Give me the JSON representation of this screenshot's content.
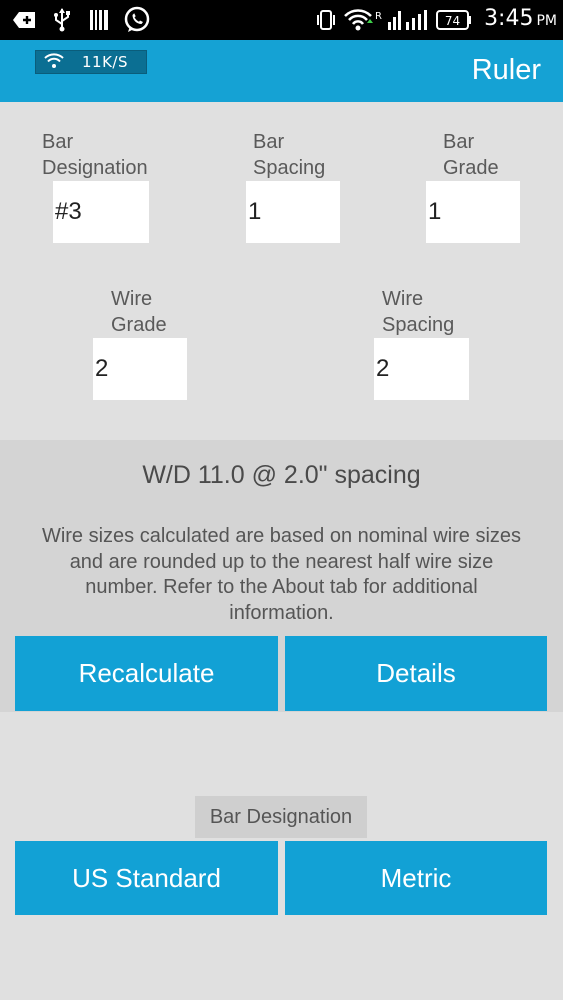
{
  "status_bar": {
    "time": "3:45",
    "ampm": "PM",
    "battery": "74",
    "net_type": "R"
  },
  "network_badge": {
    "speed": "11K/S"
  },
  "header": {
    "title": "Ruler"
  },
  "fields": {
    "bar_designation": {
      "label_line1": "Bar",
      "label_line2": "Designation",
      "value": "#3"
    },
    "bar_spacing": {
      "label_line1": "Bar",
      "label_line2": "Spacing",
      "value": "1"
    },
    "bar_grade": {
      "label_line1": "Bar",
      "label_line2": "Grade",
      "value": "1"
    },
    "wire_grade": {
      "label_line1": "Wire",
      "label_line2": "Grade",
      "value": "2"
    },
    "wire_spacing": {
      "label_line1": "Wire",
      "label_line2": "Spacing",
      "value": "2"
    }
  },
  "result": {
    "title": "W/D 11.0 @ 2.0\" spacing",
    "note_lines": [
      "Wire sizes calculated are based on nominal wire sizes",
      "and are rounded up to the nearest half wire size",
      "number. Refer to the About tab for additional",
      "information."
    ]
  },
  "buttons": {
    "recalculate": "Recalculate",
    "details": "Details",
    "us_standard": "US Standard",
    "metric": "Metric"
  },
  "units_section": {
    "label": "Bar Designation"
  },
  "colors": {
    "accent": "#15a2d4",
    "background": "#e0e0e0",
    "status_bar": "#000000"
  }
}
